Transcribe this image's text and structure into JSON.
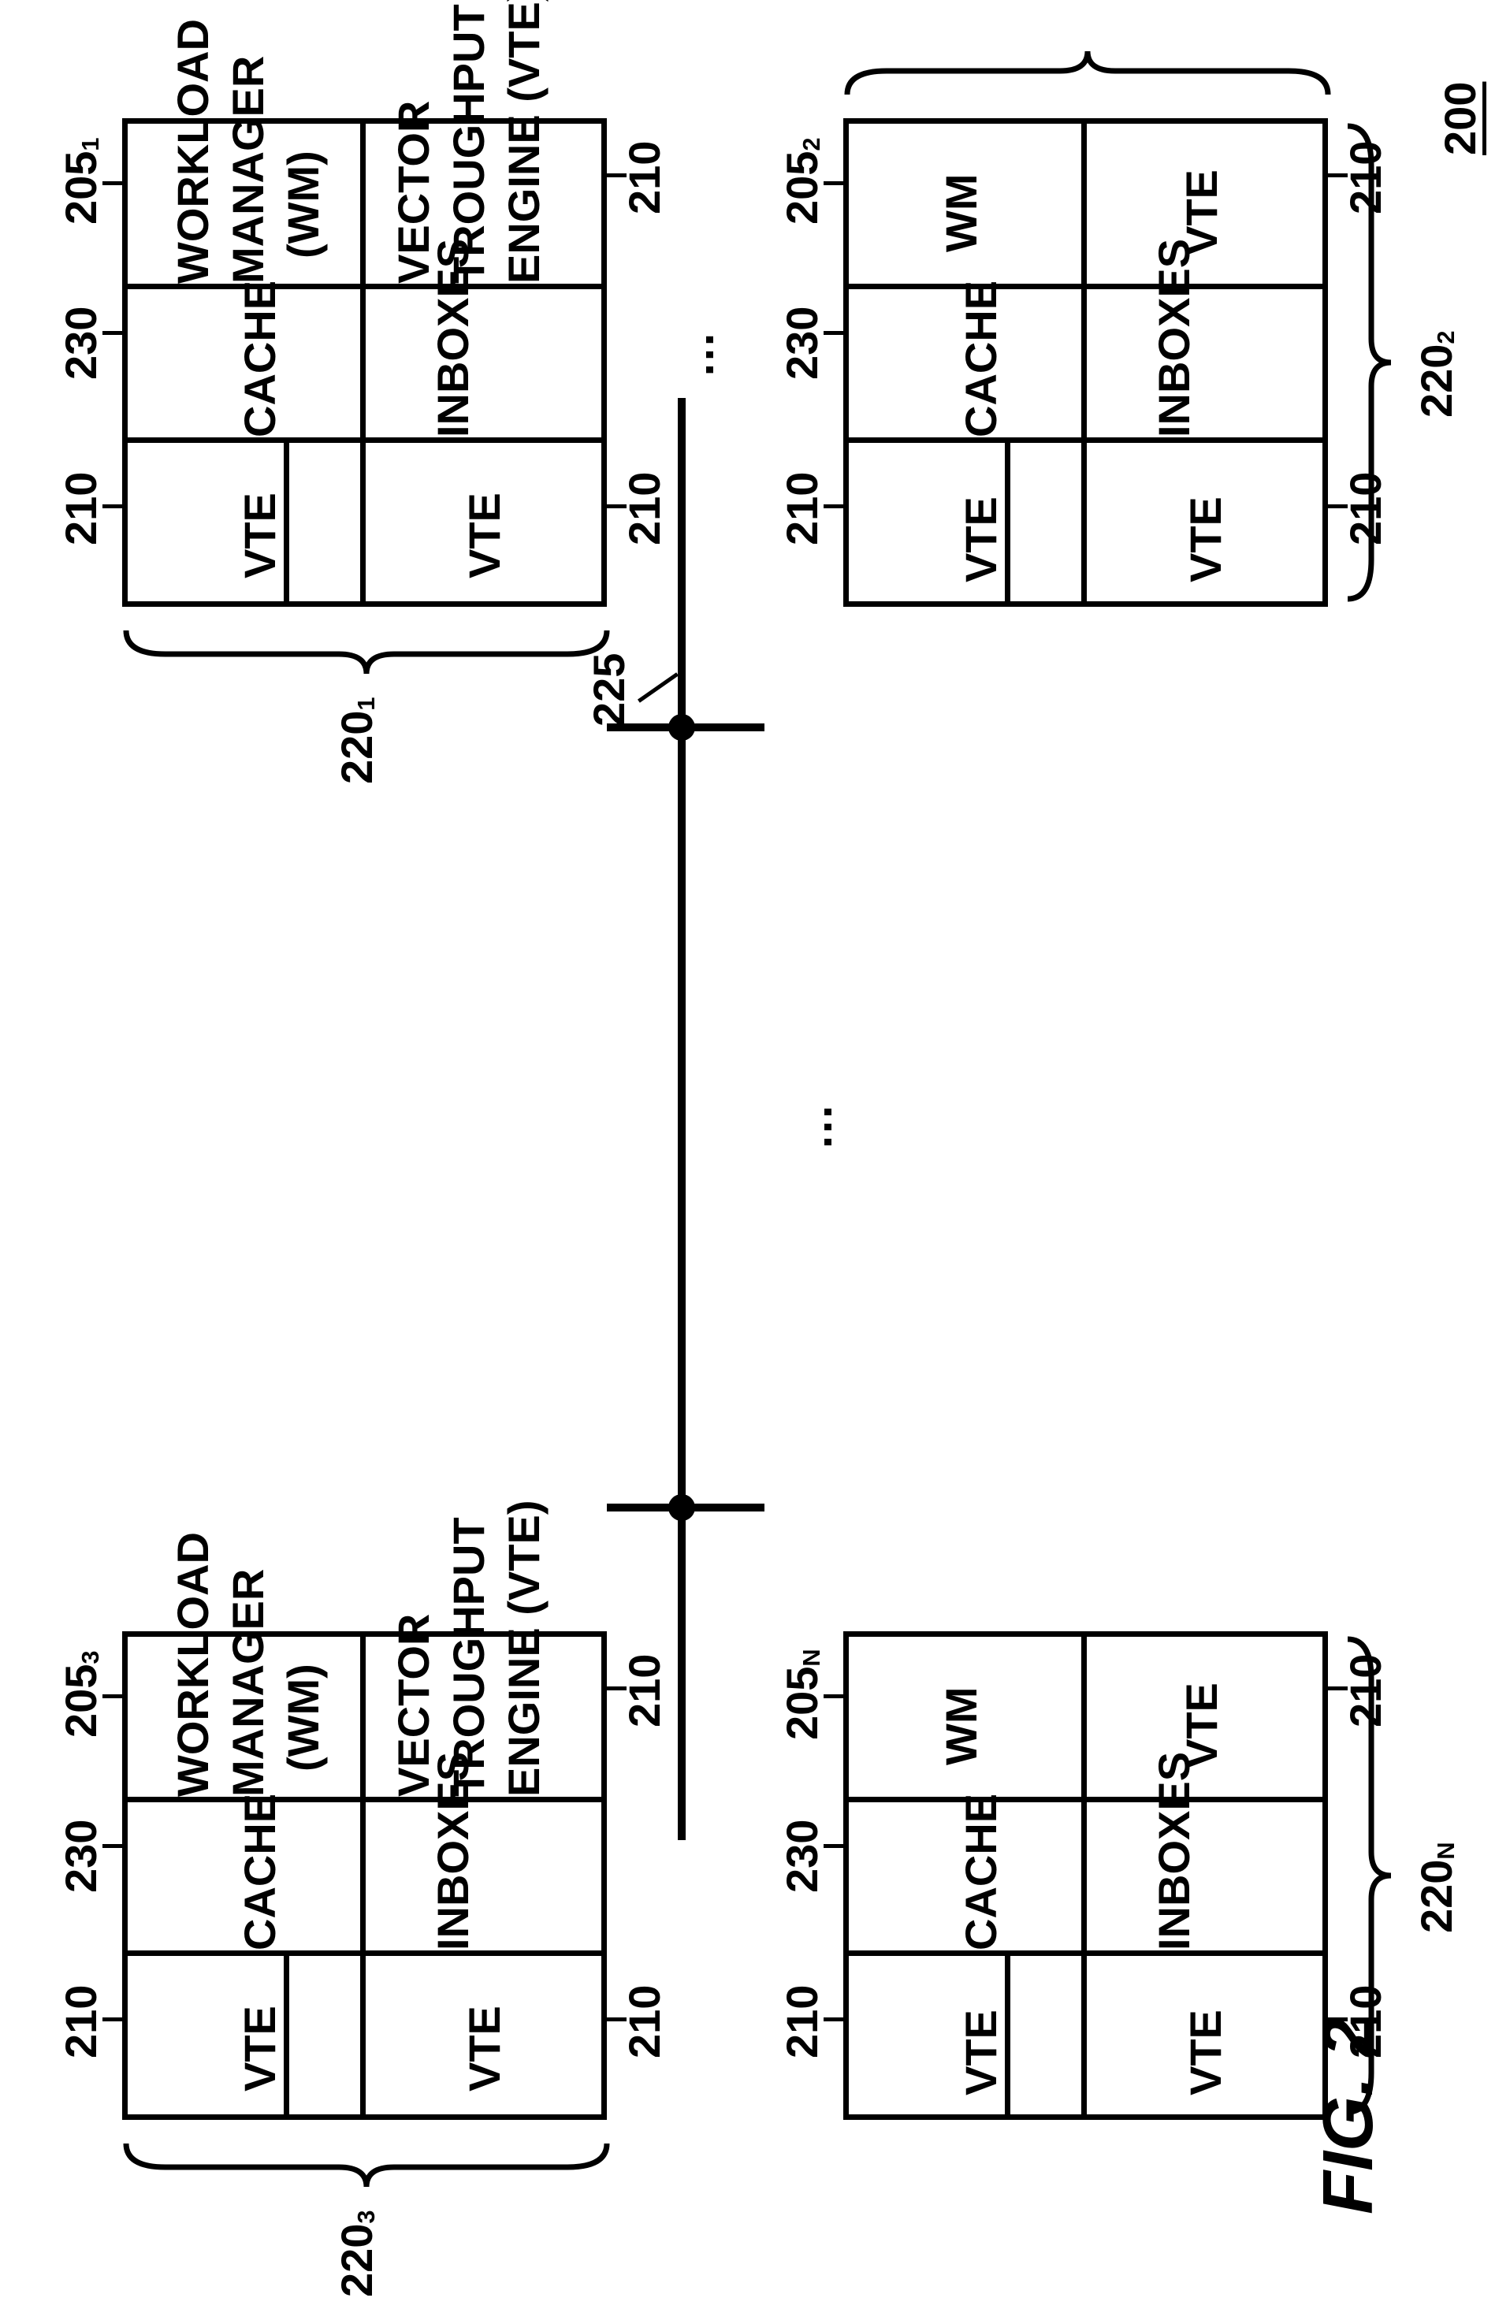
{
  "figure_number": "200",
  "figure_caption": "FIG. 2",
  "bus_label": "225",
  "groups": [
    {
      "id": "220",
      "sub": "1"
    },
    {
      "id": "220",
      "sub": "2"
    },
    {
      "id": "220",
      "sub": "3"
    },
    {
      "id": "220",
      "sub": "N"
    }
  ],
  "labels": {
    "workload_manager": "WORKLOAD\nMANAGER\n(WM)",
    "wm": "WM",
    "vte_full": "VECTOR\nTROUGHPUT\nENGINE (VTE)",
    "vte": "VTE",
    "cache": "CACHE",
    "inboxes": "INBOXES"
  },
  "ref": {
    "wm": "205",
    "vte": "210",
    "cache": "230",
    "group": "220"
  },
  "subs": {
    "tl": "1",
    "tr": "2",
    "bl": "3",
    "br": "N"
  }
}
